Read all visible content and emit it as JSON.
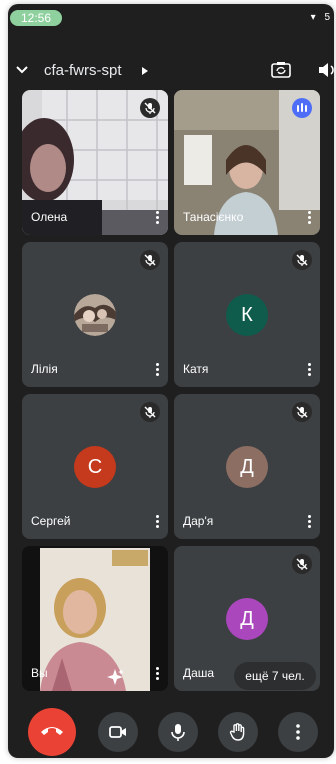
{
  "status_bar": {
    "time": "12:56",
    "battery": "5"
  },
  "header": {
    "meeting_code": "cfa-fwrs-spt"
  },
  "participants": [
    {
      "name": "Олена"
    },
    {
      "name": "Танасієнко"
    },
    {
      "name": "Лілія"
    },
    {
      "name": "Катя",
      "initial": "К",
      "color": "#0f5c4c"
    },
    {
      "name": "Сергей",
      "initial": "С",
      "color": "#c5391c"
    },
    {
      "name": "Дар'я",
      "initial": "Д",
      "color": "#8d6e63"
    },
    {
      "name": "Вы"
    },
    {
      "name": "Даша",
      "initial": "Д",
      "color": "#ab47bc"
    }
  ],
  "more_people": "ещё 7 чел.",
  "colors": {
    "end_call": "#ea4335",
    "tile": "#3c4043",
    "background": "#1f1f1f",
    "speaking": "#4f6ef7"
  }
}
